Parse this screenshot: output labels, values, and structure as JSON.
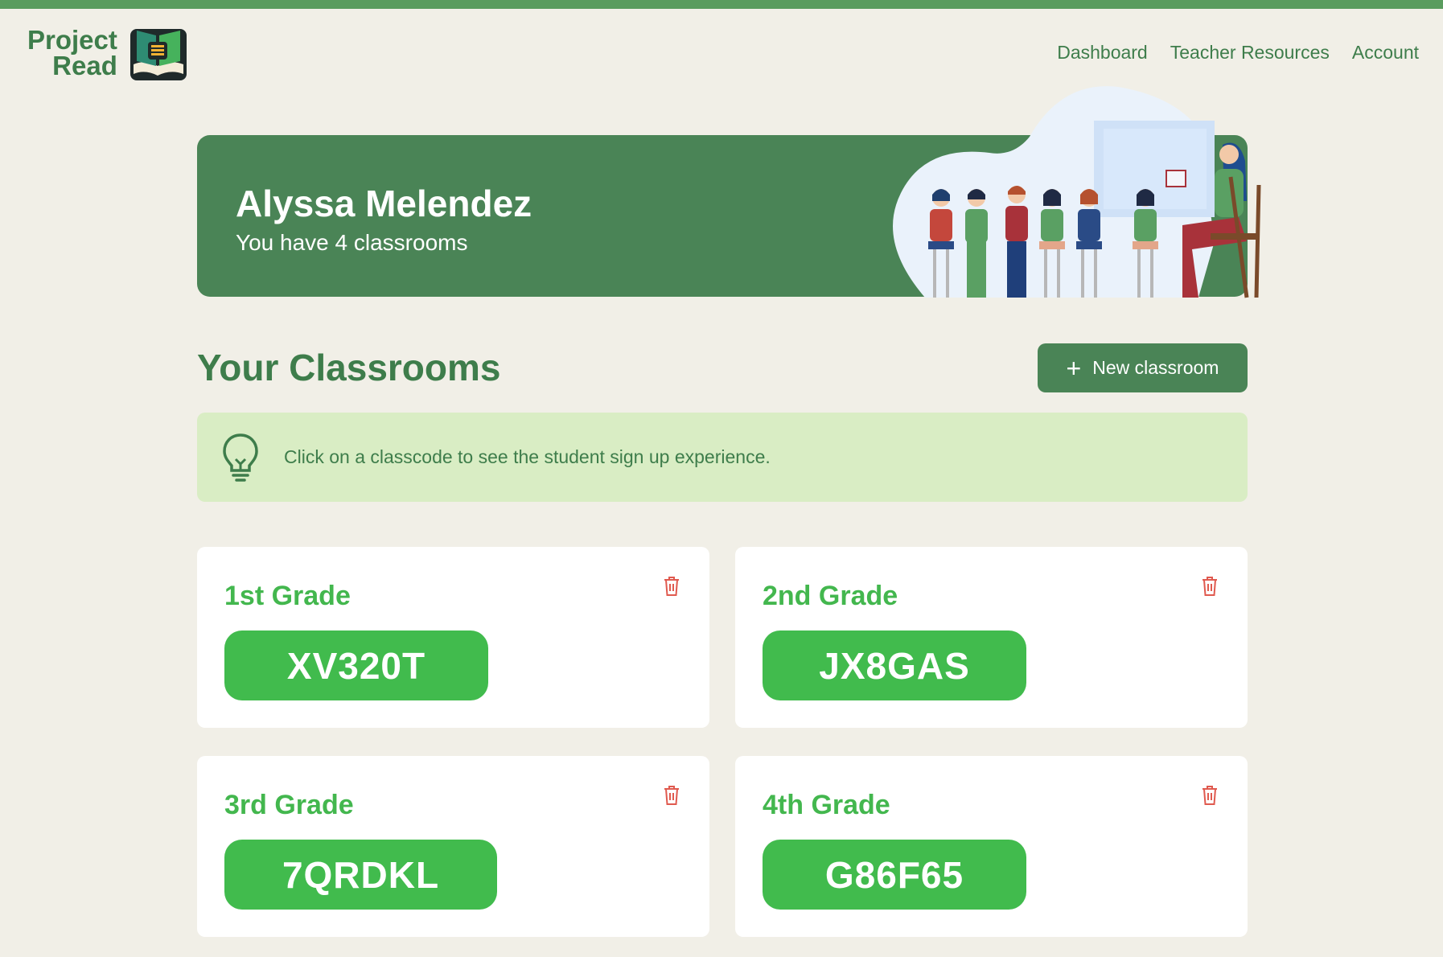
{
  "brand": {
    "line1": "Project",
    "line2": "Read"
  },
  "nav": {
    "items": [
      "Dashboard",
      "Teacher Resources",
      "Account"
    ]
  },
  "hero": {
    "name": "Alyssa Melendez",
    "subtitle": "You have 4 classrooms"
  },
  "section": {
    "title": "Your Classrooms",
    "new_button_label": "New classroom"
  },
  "tip": {
    "text": "Click on a classcode to see the student sign up experience."
  },
  "classrooms": [
    {
      "name": "1st Grade",
      "code": "XV320T"
    },
    {
      "name": "2nd Grade",
      "code": "JX8GAS"
    },
    {
      "name": "3rd Grade",
      "code": "7QRDKL"
    },
    {
      "name": "4th Grade",
      "code": "G86F65"
    }
  ],
  "colors": {
    "brand_green": "#3e7d4b",
    "banner_green": "#4a8456",
    "code_green": "#41bb4d",
    "tip_background": "#d9edc4",
    "page_background": "#f1efe7",
    "delete_red": "#e05a4f"
  },
  "icons": {
    "tip": "lightbulb-icon",
    "delete": "trash-icon",
    "add": "plus-icon"
  }
}
